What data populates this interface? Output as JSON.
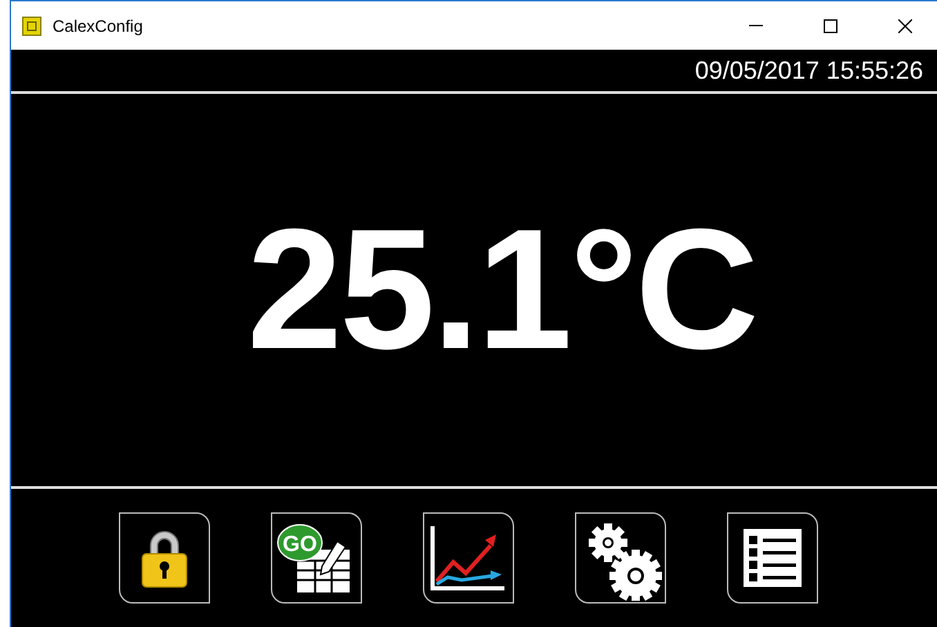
{
  "window": {
    "title": "CalexConfig"
  },
  "datetime": "09/05/2017 15:55:26",
  "temperature": "25.1°C",
  "buttons": [
    {
      "kind": "lock"
    },
    {
      "kind": "go-table",
      "badge": "GO"
    },
    {
      "kind": "chart"
    },
    {
      "kind": "gears"
    },
    {
      "kind": "list"
    }
  ]
}
